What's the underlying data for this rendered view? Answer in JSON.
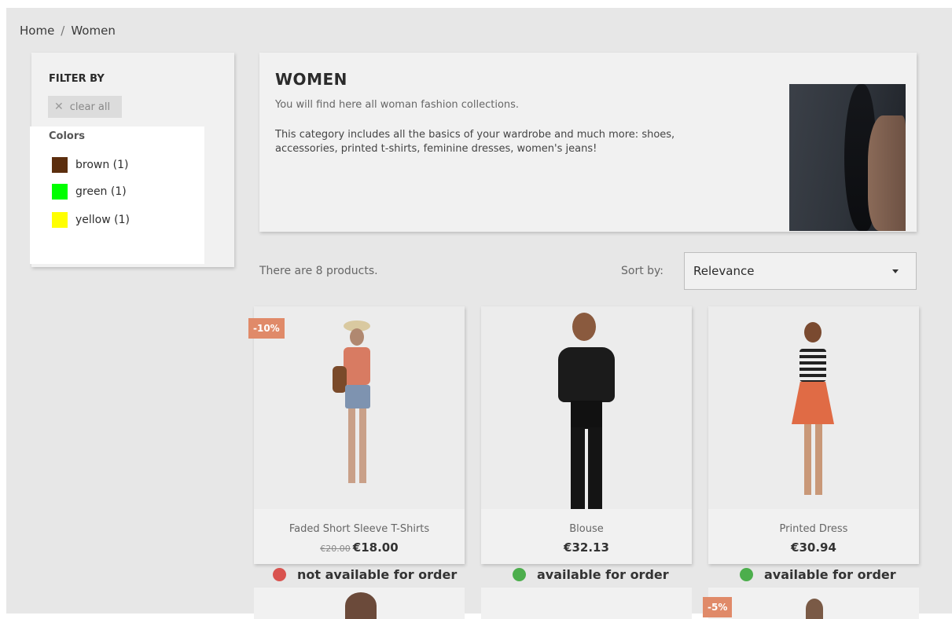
{
  "breadcrumb": {
    "home": "Home",
    "separator": "/",
    "current": "Women"
  },
  "filters": {
    "title": "FILTER BY",
    "clear_all": "clear all",
    "clear_icon": "close-icon",
    "facet_title": "Colors",
    "colors": [
      {
        "label": "brown (1)",
        "color": "#5c2e0e"
      },
      {
        "label": "green (1)",
        "color": "#00ff00"
      },
      {
        "label": "yellow (1)",
        "color": "#ffff00"
      }
    ]
  },
  "category": {
    "title": "WOMEN",
    "description_line1": "You will find here all woman fashion collections.",
    "description_line2": "This category includes all the basics of your wardrobe and much more: shoes, accessories, printed t-shirts, feminine dresses, women's jeans!"
  },
  "toolbar": {
    "product_count": "There are 8 products.",
    "sort_label": "Sort by:",
    "sort_value": "Relevance"
  },
  "products": [
    {
      "name": "Faded Short Sleeve T-Shirts",
      "old_price": "€20.00",
      "price": "€18.00",
      "badge": "-10%",
      "availability": "not available for order",
      "availability_color": "#d9534f"
    },
    {
      "name": "Blouse",
      "old_price": "",
      "price": "€32.13",
      "badge": "",
      "availability": "available for order",
      "availability_color": "#4cae4c"
    },
    {
      "name": "Printed Dress",
      "old_price": "",
      "price": "€30.94",
      "badge": "",
      "availability": "available for order",
      "availability_color": "#4cae4c"
    }
  ],
  "row2_badge": "-5%",
  "colors": {
    "overlay_bg": "#e7e7e7",
    "badge": "#e08a69",
    "unavailable": "#d9534f",
    "available": "#4cae4c"
  }
}
